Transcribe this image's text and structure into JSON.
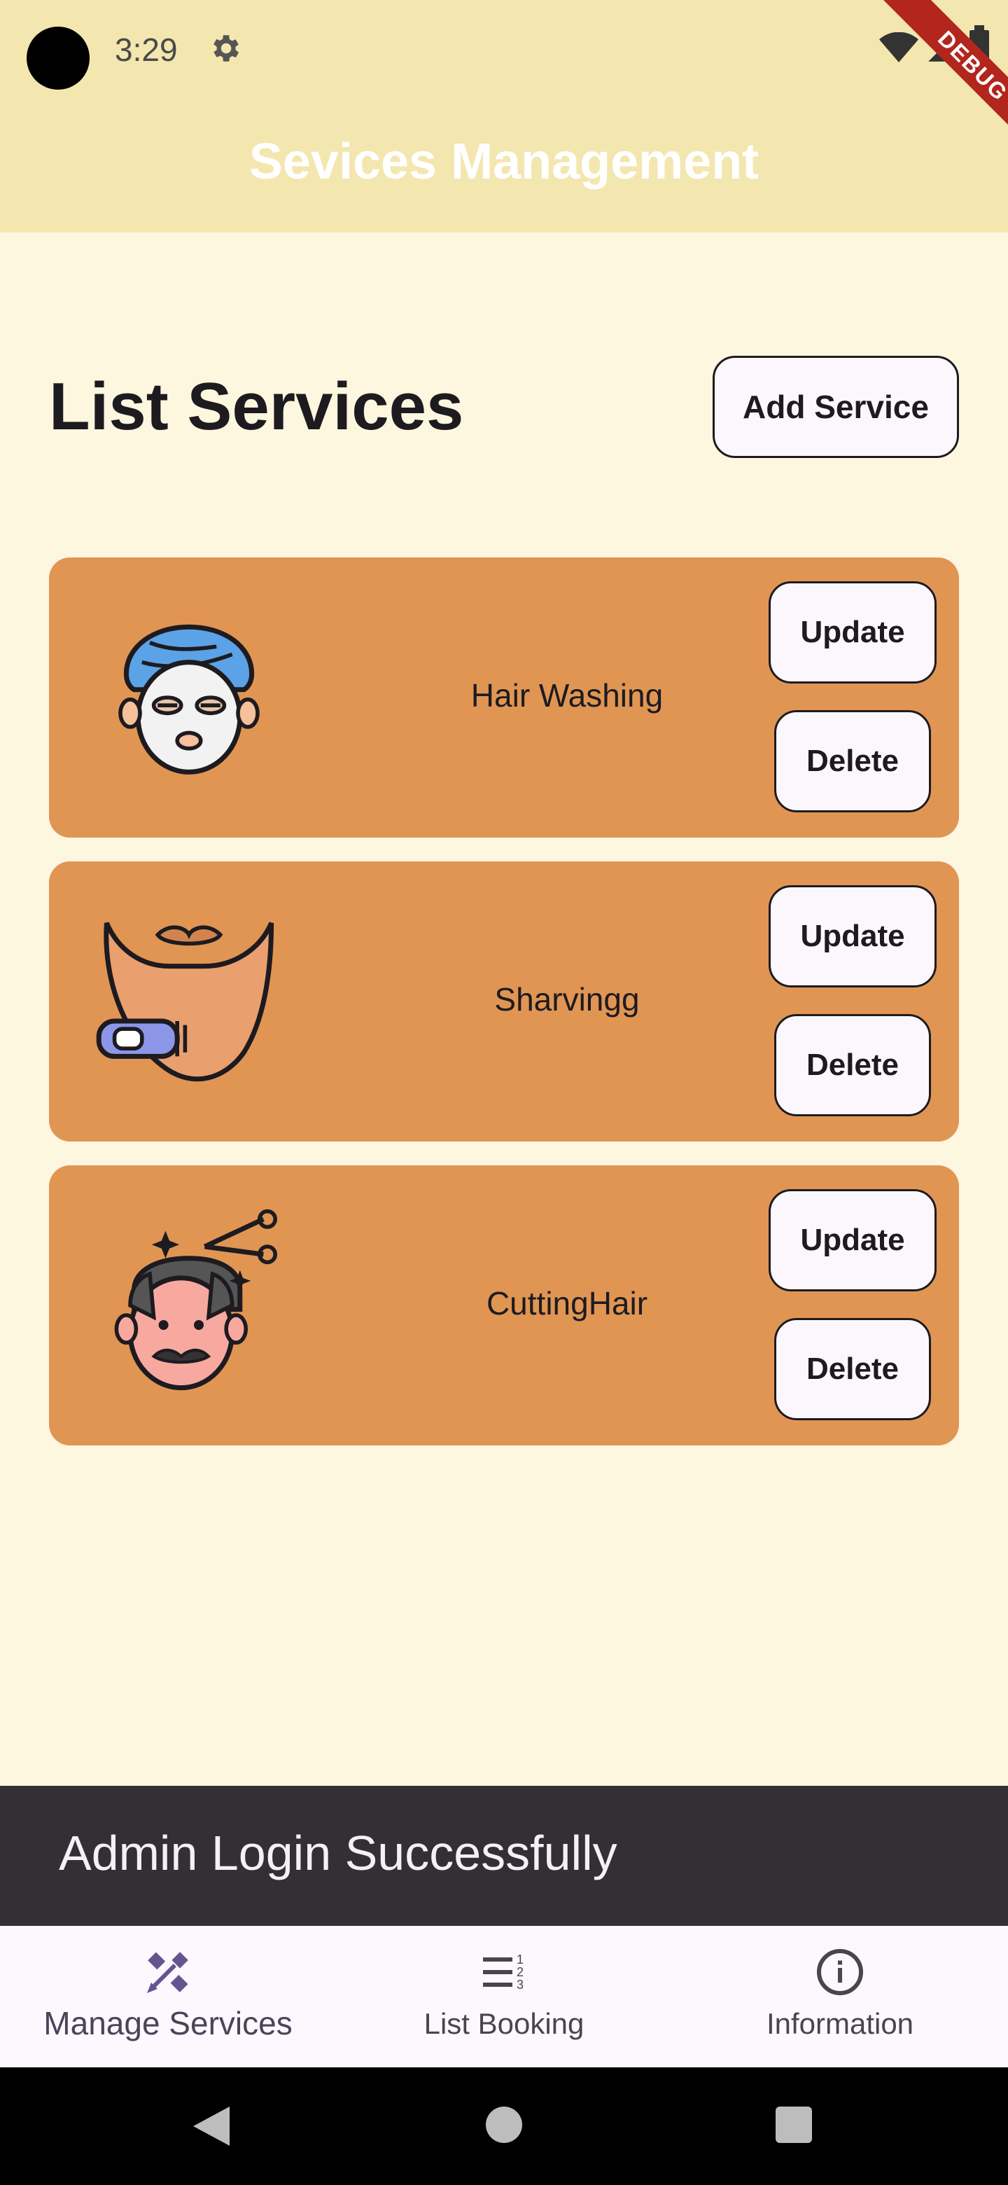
{
  "status_bar": {
    "time": "3:29"
  },
  "debug_banner": "DEBUG",
  "app_bar": {
    "title": "Sevices Management"
  },
  "header": {
    "heading": "List Services",
    "add_button_label": "Add Service"
  },
  "services": [
    {
      "name": "Hair Washing",
      "icon": "face-mask-towel-icon",
      "update_label": "Update",
      "delete_label": "Delete"
    },
    {
      "name": "Sharvingg",
      "icon": "beard-trimmer-icon",
      "update_label": "Update",
      "delete_label": "Delete"
    },
    {
      "name": "CuttingHair",
      "icon": "haircut-scissors-icon",
      "update_label": "Update",
      "delete_label": "Delete"
    }
  ],
  "snackbar": {
    "message": "Admin Login Successfully"
  },
  "bottom_nav": {
    "items": [
      {
        "label": "Manage Services",
        "icon": "tools-icon",
        "selected": true
      },
      {
        "label": "List Booking",
        "icon": "numbered-list-icon",
        "selected": false
      },
      {
        "label": "Information",
        "icon": "info-icon",
        "selected": false
      }
    ]
  },
  "colors": {
    "background": "#FDF7DF",
    "app_bar": "#F3E6AF",
    "card": "#E19553",
    "snackbar": "#322F35",
    "nav_selected": "#65558F",
    "debug": "#B3261E"
  }
}
